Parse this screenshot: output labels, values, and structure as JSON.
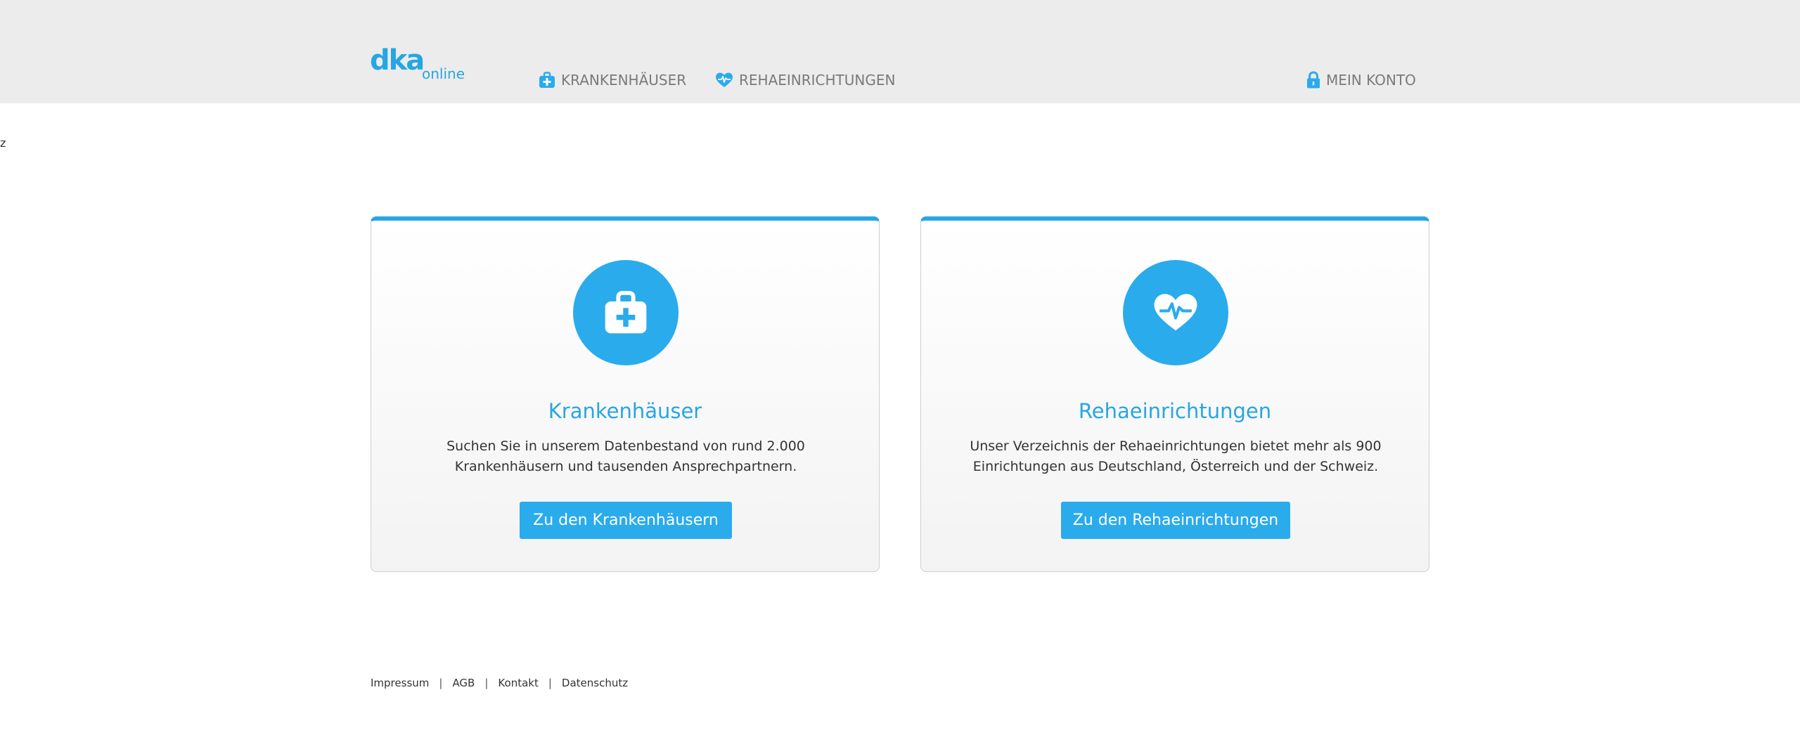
{
  "header": {
    "logo": {
      "mark": "dka",
      "suffix": "online"
    },
    "nav": {
      "krankenhaeuser": "KRANKENHÄUSER",
      "rehaeinrichtungen": "REHAEINRICHTUNGEN",
      "konto": "MEIN KONTO"
    }
  },
  "stray_text": "z",
  "cards": [
    {
      "title": "Krankenhäuser",
      "text": "Suchen Sie in unserem Datenbestand von rund 2.000 Krankenhäusern und tausenden Ansprechpartnern.",
      "button": "Zu den Krankenhäusern",
      "icon": "medical-kit-icon"
    },
    {
      "title": "Rehaeinrichtungen",
      "text": "Unser Verzeichnis der Rehaeinrichtungen bietet mehr als 900 Einrichtungen aus Deutschland, Österreich und der Schweiz.",
      "button": "Zu den Rehaeinrichtungen",
      "icon": "heartbeat-icon"
    }
  ],
  "footer": {
    "links": [
      "Impressum",
      "AGB",
      "Kontakt",
      "Datenschutz"
    ],
    "separator": "|"
  },
  "colors": {
    "accent": "#2aabec",
    "header_bg": "#ececec",
    "nav_text": "#7a7a7a"
  }
}
